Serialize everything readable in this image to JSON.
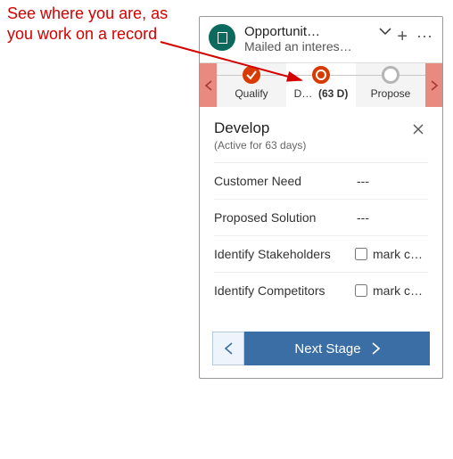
{
  "annotation": {
    "line1": "See where you are, as",
    "line2": "you work on a record"
  },
  "header": {
    "title": "Opportunit…",
    "subtitle": "Mailed an interes…"
  },
  "stages": {
    "s1": {
      "label": "Qualify",
      "state": "complete"
    },
    "s2": {
      "label": "D…",
      "duration": "(63 D)",
      "state": "active"
    },
    "s3": {
      "label": "Propose",
      "state": "future"
    }
  },
  "body": {
    "title": "Develop",
    "subtitle": "(Active for 63 days)"
  },
  "fields": {
    "customer_need": {
      "label": "Customer Need",
      "value": "---"
    },
    "proposed_solution": {
      "label": "Proposed Solution",
      "value": "---"
    },
    "identify_stakeholders": {
      "label": "Identify Stakeholders",
      "checkbox_label": "mark co…"
    },
    "identify_competitors": {
      "label": "Identify Competitors",
      "checkbox_label": "mark co…"
    }
  },
  "footer": {
    "next_label": "Next Stage"
  }
}
